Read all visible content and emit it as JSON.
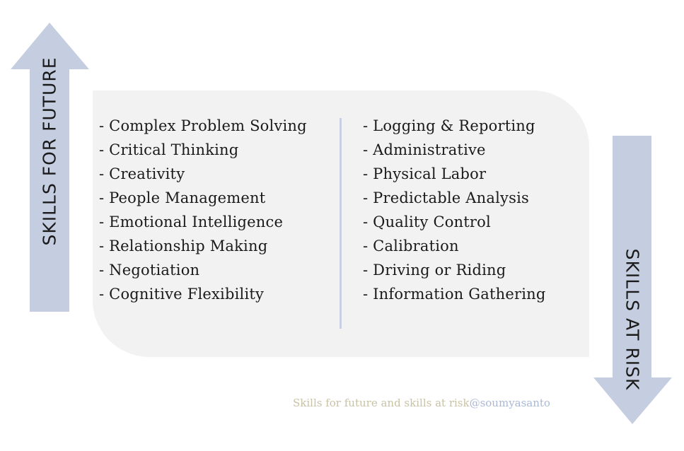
{
  "labels": {
    "future": "SKILLS FOR FUTURE",
    "risk": "SKILLS AT RISK"
  },
  "skills_for_future": [
    "- Complex Problem Solving",
    "- Critical Thinking",
    "- Creativity",
    "- People Management",
    "- Emotional Intelligence",
    "- Relationship Making",
    "- Negotiation",
    "- Cognitive Flexibility"
  ],
  "skills_at_risk": [
    "- Logging & Reporting",
    "- Administrative",
    "- Physical Labor",
    "- Predictable Analysis",
    "- Quality Control",
    "- Calibration",
    "- Driving or Riding",
    "- Information Gathering"
  ],
  "caption": {
    "text": "Skills for future and skills at risk",
    "handle": "@soumyasanto"
  },
  "colors": {
    "arrow": "#c5cde0",
    "panel": "#f2f2f2",
    "divider": "#c7d1e1",
    "caption_text": "#c8c3a4",
    "caption_handle": "#a9b8d4"
  }
}
